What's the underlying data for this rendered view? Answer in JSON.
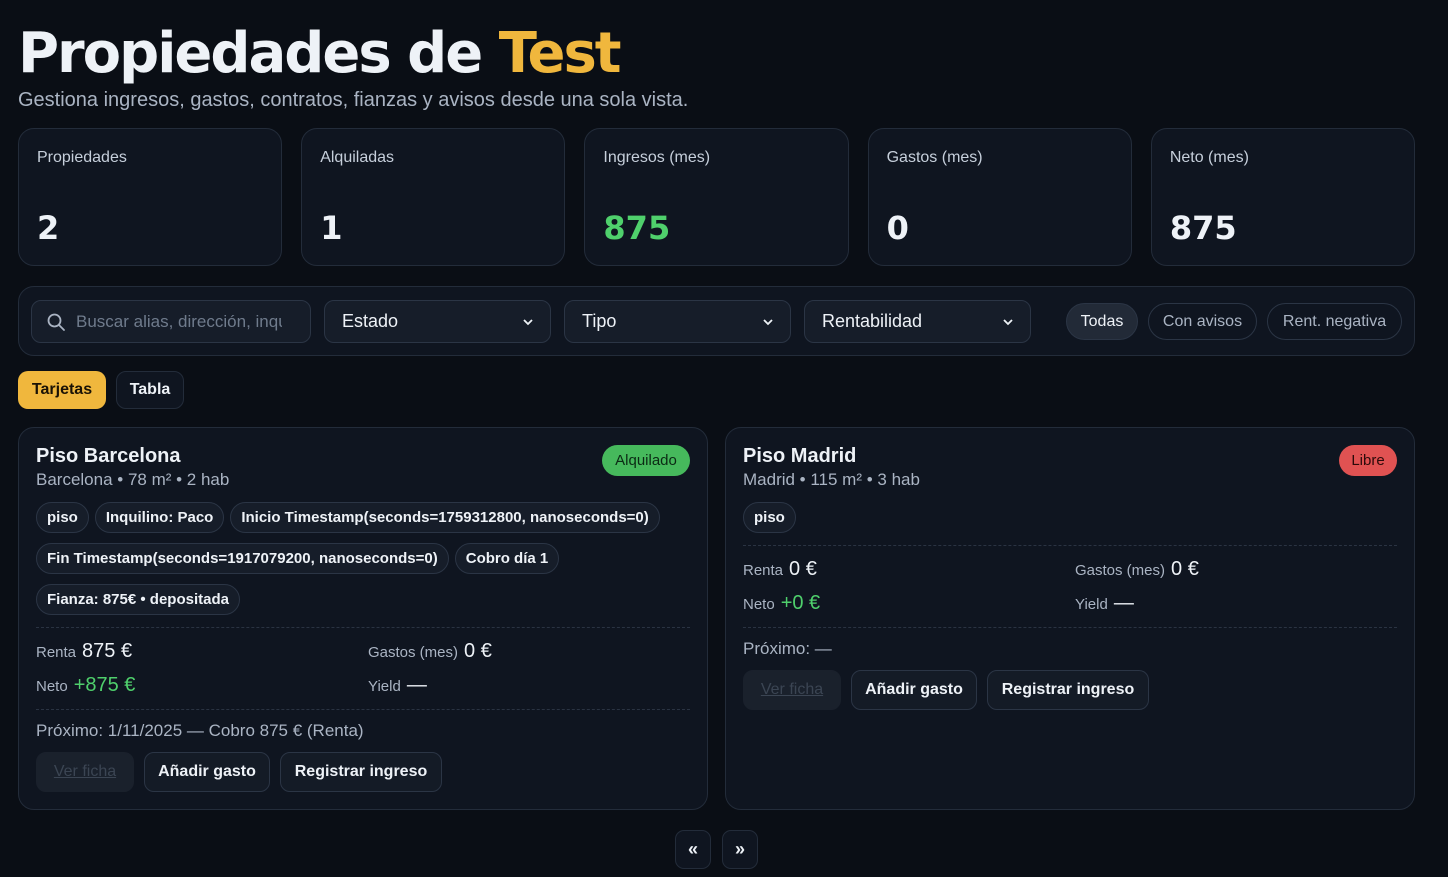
{
  "header": {
    "title_prefix": "Propiedades de",
    "title_accent": "Test",
    "subtitle": "Gestiona ingresos, gastos, contratos, fianzas y avisos desde una sola vista."
  },
  "stats": [
    {
      "label": "Propiedades",
      "value": "2"
    },
    {
      "label": "Alquiladas",
      "value": "1"
    },
    {
      "label": "Ingresos (mes)",
      "value": "875"
    },
    {
      "label": "Gastos (mes)",
      "value": "0"
    },
    {
      "label": "Neto (mes)",
      "value": "875"
    }
  ],
  "filters": {
    "search_placeholder": "Buscar alias, dirección, inquilino...",
    "estado": "Estado",
    "tipo": "Tipo",
    "rentabilidad": "Rentabilidad",
    "chips": [
      "Todas",
      "Con avisos",
      "Rent. negativa"
    ]
  },
  "view_tabs": [
    "Tarjetas",
    "Tabla"
  ],
  "cards": [
    {
      "name": "Piso Barcelona",
      "meta": "Barcelona • 78 m² • 2 hab",
      "status": "Alquilado",
      "tags": [
        "piso",
        "Inquilino: Paco",
        "Inicio Timestamp(seconds=1759312800, nanoseconds=0)",
        "Fin Timestamp(seconds=1917079200, nanoseconds=0)",
        "Cobro día 1",
        "Fianza: 875€ • depositada"
      ],
      "renta_label": "Renta",
      "renta": "875 €",
      "gastos_label": "Gastos (mes)",
      "gastos": "0 €",
      "neto_label": "Neto",
      "neto": "+875 €",
      "yield_label": "Yield",
      "yield": "—",
      "next": "Próximo: 1/11/2025 — Cobro 875 € (Renta)",
      "buttons": [
        "Ver ficha",
        "Añadir gasto",
        "Registrar ingreso"
      ]
    },
    {
      "name": "Piso Madrid",
      "meta": "Madrid • 115 m² • 3 hab",
      "status": "Libre",
      "tags": [
        "piso"
      ],
      "renta_label": "Renta",
      "renta": "0 €",
      "gastos_label": "Gastos (mes)",
      "gastos": "0 €",
      "neto_label": "Neto",
      "neto": "+0 €",
      "yield_label": "Yield",
      "yield": "—",
      "next": "Próximo: —",
      "buttons": [
        "Ver ficha",
        "Añadir gasto",
        "Registrar ingreso"
      ]
    }
  ],
  "pager": {
    "prev": "«",
    "next": "»"
  }
}
